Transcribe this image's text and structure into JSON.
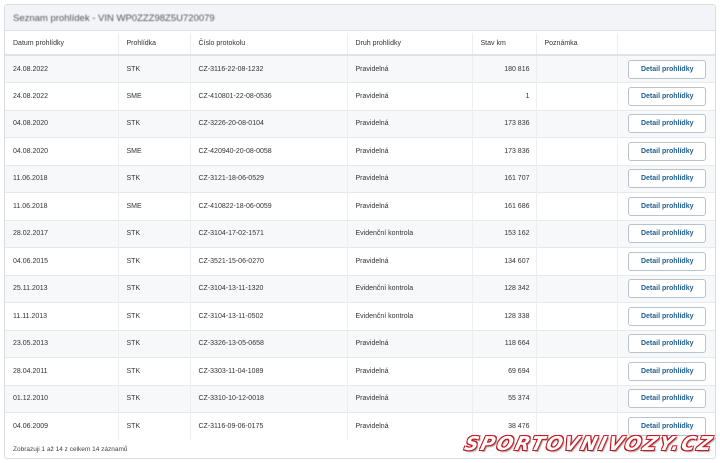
{
  "header": {
    "title": "Seznam prohlídek - VIN WP0ZZZ98Z5U720079"
  },
  "table": {
    "columns": [
      "Datum prohlídky",
      "Prohlídka",
      "Číslo protokolu",
      "Druh prohlídky",
      "Stav km",
      "Poznámka",
      ""
    ],
    "action_label": "Detail prohlídky",
    "rows": [
      {
        "date": "24.08.2022",
        "type": "STK",
        "protocol": "CZ-3116-22-08-1232",
        "kind": "Pravidelná",
        "km": "180 816",
        "note": ""
      },
      {
        "date": "24.08.2022",
        "type": "SME",
        "protocol": "CZ-410801-22-08-0536",
        "kind": "Pravidelná",
        "km": "1",
        "note": ""
      },
      {
        "date": "04.08.2020",
        "type": "STK",
        "protocol": "CZ-3226-20-08-0104",
        "kind": "Pravidelná",
        "km": "173 836",
        "note": ""
      },
      {
        "date": "04.08.2020",
        "type": "SME",
        "protocol": "CZ-420940-20-08-0058",
        "kind": "Pravidelná",
        "km": "173 836",
        "note": ""
      },
      {
        "date": "11.06.2018",
        "type": "STK",
        "protocol": "CZ-3121-18-06-0529",
        "kind": "Pravidelná",
        "km": "161 707",
        "note": ""
      },
      {
        "date": "11.06.2018",
        "type": "SME",
        "protocol": "CZ-410822-18-06-0059",
        "kind": "Pravidelná",
        "km": "161 686",
        "note": ""
      },
      {
        "date": "28.02.2017",
        "type": "STK",
        "protocol": "CZ-3104-17-02-1571",
        "kind": "Evidenční kontrola",
        "km": "153 162",
        "note": ""
      },
      {
        "date": "04.06.2015",
        "type": "STK",
        "protocol": "CZ-3521-15-06-0270",
        "kind": "Pravidelná",
        "km": "134 607",
        "note": ""
      },
      {
        "date": "25.11.2013",
        "type": "STK",
        "protocol": "CZ-3104-13-11-1320",
        "kind": "Evidenční kontrola",
        "km": "128 342",
        "note": ""
      },
      {
        "date": "11.11.2013",
        "type": "STK",
        "protocol": "CZ-3104-13-11-0502",
        "kind": "Evidenční kontrola",
        "km": "128 338",
        "note": ""
      },
      {
        "date": "23.05.2013",
        "type": "STK",
        "protocol": "CZ-3326-13-05-0658",
        "kind": "Pravidelná",
        "km": "118 664",
        "note": ""
      },
      {
        "date": "28.04.2011",
        "type": "STK",
        "protocol": "CZ-3303-11-04-1089",
        "kind": "Pravidelná",
        "km": "69 694",
        "note": ""
      },
      {
        "date": "01.12.2010",
        "type": "STK",
        "protocol": "CZ-3310-10-12-0018",
        "kind": "Pravidelná",
        "km": "55 374",
        "note": ""
      },
      {
        "date": "04.06.2009",
        "type": "STK",
        "protocol": "CZ-3116-09-06-0175",
        "kind": "Pravidelná",
        "km": "38 476",
        "note": ""
      }
    ]
  },
  "footer": {
    "info": "Zobrazuji 1 až 14 z celkem 14 záznamů"
  },
  "watermark": {
    "text": "SPORTOVNIVOZY.CZ"
  }
}
